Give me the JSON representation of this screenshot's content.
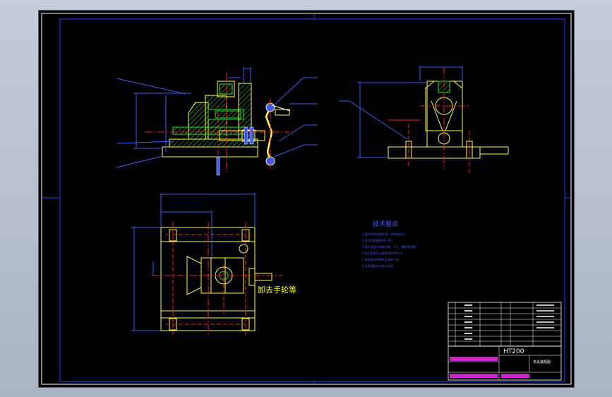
{
  "drawing": {
    "callout_label": "卸去手轮等",
    "tech_requirements": {
      "title": "技术要求",
      "lines": [
        "1.铸件应经时效处理，消除内应力。",
        "2.未注铸造圆角R2~R5。",
        "3.铸件表面不得有砂眼、气孔、缩松等缺陷。",
        "4.加工面未注公差按GB1804-m。",
        "5.装配前所有零件应清洗干净。",
        "6.夹具装配后应进行检验。"
      ]
    },
    "title_block": {
      "material": "HT200",
      "drawing_name": "夹具装配图"
    }
  },
  "colors": {
    "frame": "#2a3cff",
    "outline": "#ffff40",
    "center": "#ff2020",
    "hatch": "#30e030",
    "dim": "#3a5bff",
    "white": "#ffffff",
    "magenta": "#ff30ff"
  }
}
